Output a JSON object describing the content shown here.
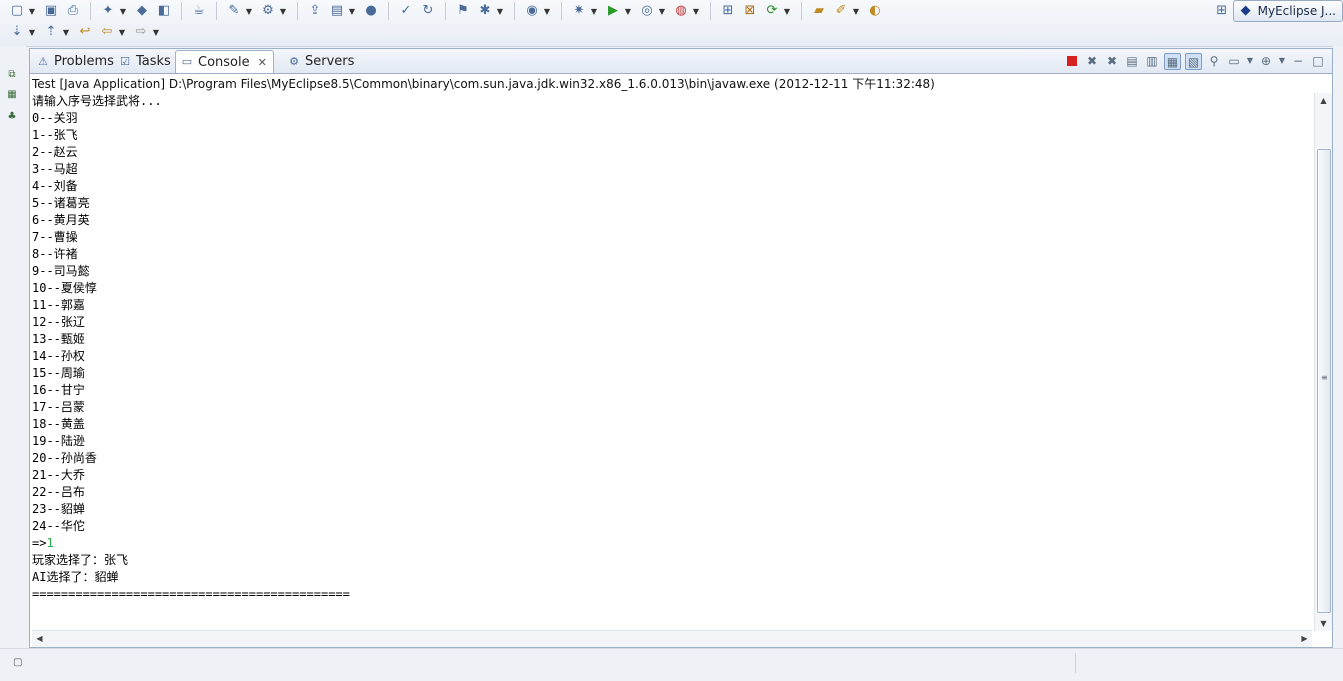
{
  "toolbar": {
    "row1_icons": [
      "new-icon",
      "save-icon",
      "print-icon",
      "new-wizard-icon",
      "open-type-icon",
      "open-resource-icon",
      "java-project-icon",
      "new-class-icon",
      "server-icon",
      "deploy-icon",
      "browser-icon",
      "task-icon",
      "bug-icon",
      "external-tools-icon",
      "camera-icon",
      "debug-icon",
      "run-icon",
      "run-history-icon",
      "coverage-icon",
      "web-project-icon",
      "ejb-icon",
      "refresh-icon",
      "package-icon",
      "build-icon",
      "ant-icon"
    ],
    "row2_icons": [
      "next-annotation-icon",
      "prev-annotation-icon",
      "last-edit-icon",
      "back-icon",
      "forward-icon"
    ],
    "perspective_label": "MyEclipse J..."
  },
  "tabs": [
    {
      "label": "Problems",
      "icon": "problems-icon"
    },
    {
      "label": "Tasks",
      "icon": "tasks-icon"
    },
    {
      "label": "Console",
      "icon": "console-icon",
      "active": true
    },
    {
      "label": "Servers",
      "icon": "servers-icon"
    }
  ],
  "console": {
    "description": "Test [Java Application] D:\\Program Files\\MyEclipse8.5\\Common\\binary\\com.sun.java.jdk.win32.x86_1.6.0.013\\bin\\javaw.exe (2012-12-11 下午11:32:48)",
    "lines": [
      {
        "text": "请输入序号选择武将..."
      },
      {
        "text": "0--关羽"
      },
      {
        "text": "1--张飞"
      },
      {
        "text": "2--赵云"
      },
      {
        "text": "3--马超"
      },
      {
        "text": "4--刘备"
      },
      {
        "text": "5--诸葛亮"
      },
      {
        "text": "6--黄月英"
      },
      {
        "text": "7--曹操"
      },
      {
        "text": "8--许褚"
      },
      {
        "text": "9--司马懿"
      },
      {
        "text": "10--夏侯惇"
      },
      {
        "text": "11--郭嘉"
      },
      {
        "text": "12--张辽"
      },
      {
        "text": "13--甄姬"
      },
      {
        "text": "14--孙权"
      },
      {
        "text": "15--周瑜"
      },
      {
        "text": "16--甘宁"
      },
      {
        "text": "17--吕蒙"
      },
      {
        "text": "18--黄盖"
      },
      {
        "text": "19--陆逊"
      },
      {
        "text": "20--孙尚香"
      },
      {
        "text": "21--大乔"
      },
      {
        "text": "22--吕布"
      },
      {
        "text": "23--貂蝉"
      },
      {
        "text": "24--华佗"
      },
      {
        "text": "=>",
        "input": "1"
      },
      {
        "text": "玩家选择了：张飞"
      },
      {
        "text": "AI选择了：貂蝉"
      },
      {
        "text": "============================================"
      }
    ]
  },
  "colors": {
    "input_text": "#2aa84a",
    "terminate": "#d72020",
    "view_border": "#9bb0c9"
  }
}
